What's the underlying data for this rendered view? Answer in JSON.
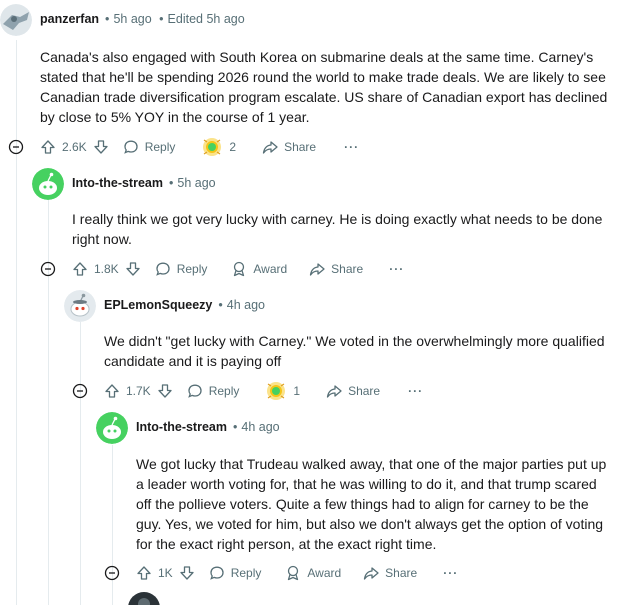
{
  "comments": [
    {
      "username": "panzerfan",
      "time": "5h ago",
      "edited": "Edited 5h ago",
      "lines": [
        "Canada's also engaged with South Korea on submarine deals at the same time. Carney's",
        "stated that he'll be spending 2026 round the world to make trade deals. We are likely to see",
        "Canadian trade diversification program escalate. US share of Canadian export has declined",
        "by close to 5% YOY in the course of 1 year."
      ],
      "votes": "2.6K",
      "reply": "Reply",
      "award_count": "2",
      "share": "Share",
      "more": "···"
    },
    {
      "username": "Into-the-stream",
      "time": "5h ago",
      "lines": [
        "I really think we got very lucky with carney. He is doing exactly what needs to be done",
        "right now."
      ],
      "votes": "1.8K",
      "reply": "Reply",
      "award": "Award",
      "share": "Share",
      "more": "···"
    },
    {
      "username": "EPLemonSqueezy",
      "time": "4h ago",
      "lines": [
        "We didn't \"get lucky with Carney.\" We voted in the overwhelmingly more qualified",
        "candidate and it is paying off"
      ],
      "votes": "1.7K",
      "reply": "Reply",
      "award_count": "1",
      "share": "Share",
      "more": "···"
    },
    {
      "username": "Into-the-stream",
      "time": "4h ago",
      "lines": [
        "We got lucky that Trudeau walked away, that one of the major parties put up",
        "a leader worth voting for, that he was willing to do it, and that trump scared",
        "off the pollieve voters. Quite a few things had to align for carney to be the",
        "guy. Yes, we voted for him, but also we don't always get the option of voting",
        "for the exact right person, at the exact right time."
      ],
      "votes": "1K",
      "reply": "Reply",
      "award": "Award",
      "share": "Share",
      "more": "···"
    }
  ],
  "colors": {
    "text": "#1a1a1b",
    "meta": "#576f76",
    "thread": "#e5ebee",
    "snoo_green": "#46d160",
    "award_gold": "#f5c518"
  },
  "icons": {
    "collapse": "minus-circle-icon",
    "upvote": "arrow-up-icon",
    "downvote": "arrow-down-icon",
    "reply": "speech-bubble-icon",
    "award": "award-icon",
    "share": "share-arrow-icon"
  }
}
